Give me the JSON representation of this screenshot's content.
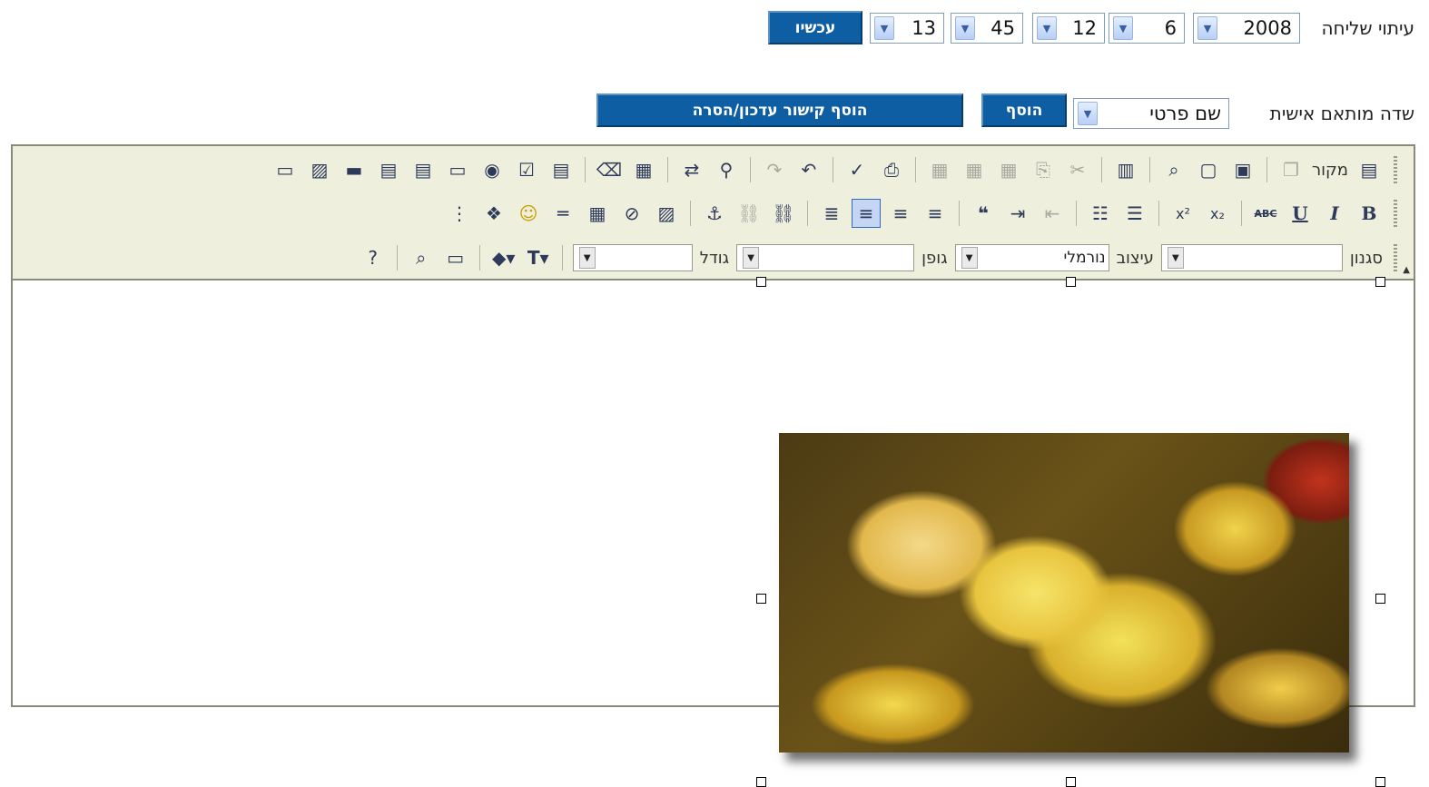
{
  "schedule": {
    "label": "עיתוי שליחה",
    "year": "2008",
    "month": "6",
    "day": "12",
    "minute": "45",
    "hour": "13",
    "now_button": "עכשיו"
  },
  "custom_field": {
    "label": "שדה מותאם אישית",
    "selected": "שם פרטי",
    "add_button": "הוסף",
    "link_button": "הוסף קישור עדכון/הסרה"
  },
  "toolbar": {
    "source_label": "מקור",
    "style_label": "סגנון",
    "format_label": "עיצוב",
    "format_value": "נורמלי",
    "font_label": "גופן",
    "size_label": "גודל",
    "bold_glyph": "B",
    "italic_glyph": "I",
    "underline_glyph": "U",
    "strike_glyph": "ABC",
    "spell_glyph": "ABC"
  },
  "editor": {
    "image_icon": "yellow-lilies-photo"
  }
}
